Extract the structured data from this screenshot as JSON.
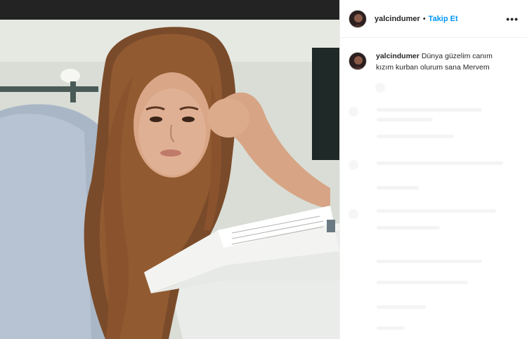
{
  "post": {
    "username": "yalcindumer",
    "follow_label": "Takip Et",
    "separator": "•",
    "more_icon": "more-options-icon",
    "caption": "Dünya güzelim canım kızım kurban olurum sana Mervem"
  },
  "colors": {
    "follow": "#0095f6",
    "text": "#262626",
    "border": "#efefef"
  }
}
